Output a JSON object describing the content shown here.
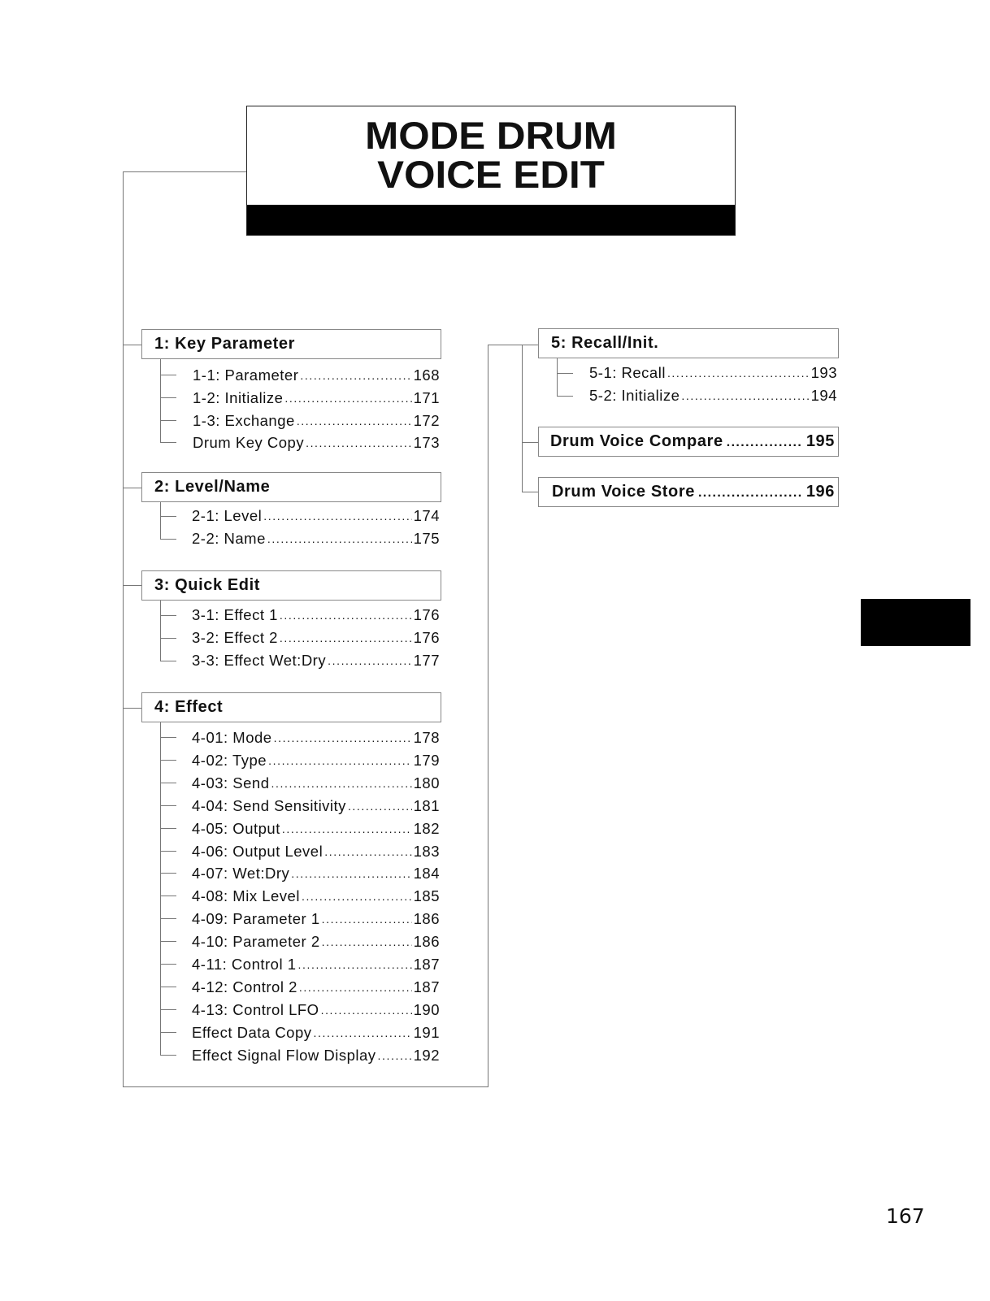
{
  "title": {
    "line1": "MODE DRUM",
    "line2": "VOICE EDIT"
  },
  "sections": [
    {
      "label": "1: Key Parameter",
      "items": [
        {
          "label": "1-1: Parameter",
          "page": "168"
        },
        {
          "label": "1-2: Initialize",
          "page": "171"
        },
        {
          "label": "1-3: Exchange",
          "page": "172"
        },
        {
          "label": "Drum Key Copy",
          "page": "173"
        }
      ]
    },
    {
      "label": "2: Level/Name",
      "items": [
        {
          "label": "2-1: Level",
          "page": "174"
        },
        {
          "label": "2-2: Name",
          "page": "175"
        }
      ]
    },
    {
      "label": "3: Quick Edit",
      "items": [
        {
          "label": "3-1: Effect 1",
          "page": "176"
        },
        {
          "label": "3-2: Effect 2",
          "page": "176"
        },
        {
          "label": "3-3: Effect Wet:Dry",
          "page": "177"
        }
      ]
    },
    {
      "label": "4: Effect",
      "items": [
        {
          "label": "4-01: Mode",
          "page": "178"
        },
        {
          "label": "4-02: Type",
          "page": "179"
        },
        {
          "label": "4-03: Send",
          "page": "180"
        },
        {
          "label": "4-04: Send Sensitivity",
          "page": "181"
        },
        {
          "label": "4-05: Output",
          "page": "182"
        },
        {
          "label": "4-06: Output Level",
          "page": "183"
        },
        {
          "label": "4-07: Wet:Dry",
          "page": "184"
        },
        {
          "label": "4-08: Mix Level",
          "page": "185"
        },
        {
          "label": "4-09: Parameter 1",
          "page": "186"
        },
        {
          "label": "4-10: Parameter 2",
          "page": "186"
        },
        {
          "label": "4-11: Control 1",
          "page": "187"
        },
        {
          "label": "4-12: Control 2",
          "page": "187"
        },
        {
          "label": "4-13: Control LFO",
          "page": "190"
        },
        {
          "label": "Effect Data Copy",
          "page": "191"
        },
        {
          "label": "Effect Signal Flow Display",
          "page": "192"
        }
      ]
    },
    {
      "label": "5: Recall/Init.",
      "items": [
        {
          "label": "5-1: Recall",
          "page": "193"
        },
        {
          "label": "5-2: Initialize",
          "page": "194"
        }
      ]
    }
  ],
  "standalone": [
    {
      "label": "Drum Voice Compare",
      "page": "195"
    },
    {
      "label": "Drum Voice Store",
      "page": "196"
    }
  ],
  "dots": "......................................................................",
  "page_number": "167"
}
